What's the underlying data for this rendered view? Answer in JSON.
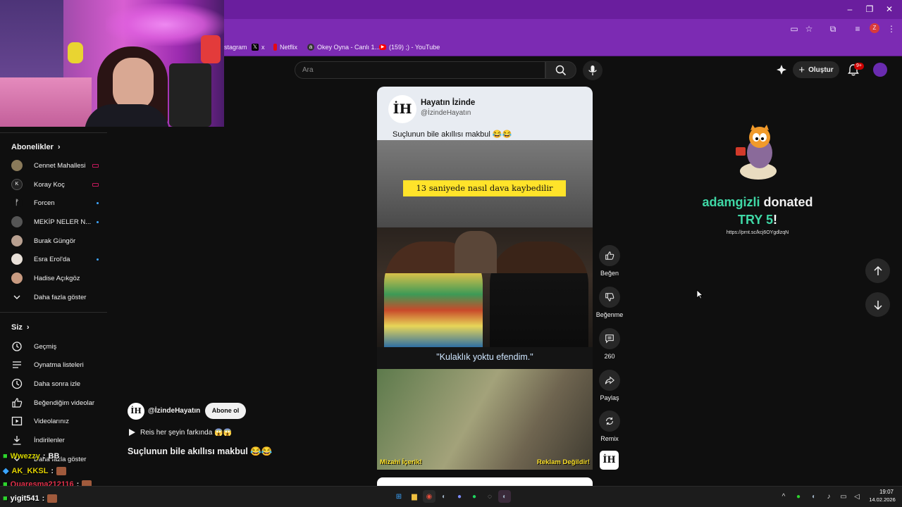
{
  "browser": {
    "bookmarks": [
      {
        "label": "stagram",
        "icon": "instagram-icon",
        "color": "#7c2bb3"
      },
      {
        "label": "x",
        "icon": "x-icon",
        "color": "#000000"
      },
      {
        "label": "Netflix",
        "icon": "netflix-icon",
        "color": "#e50914"
      },
      {
        "label": "Okey Oyna - Canlı 1...",
        "icon": "okey-icon",
        "color": "#222222"
      },
      {
        "label": "(159) ;) - YouTube",
        "icon": "youtube-icon",
        "color": "#ff0000"
      }
    ],
    "profile_letter": "Z"
  },
  "sidebar": {
    "subscriptions_title": "Abonelikler",
    "subscriptions": [
      {
        "label": "Cennet Mahallesi",
        "indicator": "live",
        "avatar_color": "#8a7a5a"
      },
      {
        "label": "Koray Koç",
        "indicator": "live",
        "avatar_color": "#222222"
      },
      {
        "label": "Forcen",
        "indicator": "dot",
        "avatar_color": "#0f0f0f"
      },
      {
        "label": "MEKİP NELER N...",
        "indicator": "dot",
        "avatar_color": "#555555"
      },
      {
        "label": "Burak Güngör",
        "indicator": "none",
        "avatar_color": "#b8a090"
      },
      {
        "label": "Esra Erol'da",
        "indicator": "dot",
        "avatar_color": "#e8e0d8"
      },
      {
        "label": "Hadise Açıkgöz",
        "indicator": "none",
        "avatar_color": "#c89a80"
      }
    ],
    "show_more": "Daha fazla göster",
    "you_title": "Siz",
    "you_items": [
      {
        "label": "Geçmiş",
        "icon": "history-icon"
      },
      {
        "label": "Oynatma listeleri",
        "icon": "playlist-icon"
      },
      {
        "label": "Daha sonra izle",
        "icon": "clock-icon"
      },
      {
        "label": "Beğendiğim videolar",
        "icon": "like-icon"
      },
      {
        "label": "Videolarınız",
        "icon": "video-icon"
      },
      {
        "label": "İndirilenler",
        "icon": "download-icon"
      },
      {
        "label": "Daha fazla göster",
        "icon": "chevron-down-icon"
      }
    ]
  },
  "header": {
    "search_placeholder": "Ara",
    "create_label": "Oluştur",
    "notification_badge": "9+"
  },
  "short": {
    "tweet_name": "Hayatın İzinde",
    "tweet_handle": "@İzindeHayatın",
    "tweet_text": "Suçlunun bile akıllısı makbul 😂😂",
    "avatar_text": "İH",
    "yellow_caption": "13 saniyede nasıl dava kaybedilir",
    "blue_caption": "\"Kulaklık yoktu efendim.\"",
    "badge_left": "Mizahi İçerik!",
    "badge_right": "Reklam Değildir!",
    "channel_name": "@İzindeHayatın",
    "subscribe_label": "Abone ol",
    "music": "Reis her şeyin farkında 😱😱",
    "title": "Suçlunun bile akıllısı makbul 😂😂"
  },
  "actions": {
    "like": "Beğen",
    "dislike": "Beğenme",
    "comments": "260",
    "share": "Paylaş",
    "remix": "Remix"
  },
  "donation": {
    "user": "adamgizli",
    "verb": "donated",
    "amount": "TRY 5",
    "exclaim": "!",
    "url": "https://prnt.sc/kcj6OYgdlzqN",
    "user_color": "#3fd8a6"
  },
  "chat": [
    {
      "user": "Wwezzy",
      "text": "BB",
      "color": "#d4d400"
    },
    {
      "user": "AK_KKSL",
      "text": ":",
      "color": "#e0d000"
    },
    {
      "user": "Quaresma212116",
      "text": ":",
      "color": "#e0304a"
    },
    {
      "user": "yigit541",
      "text": ":",
      "color": "#ffffff"
    }
  ],
  "taskbar": {
    "time": "19:07",
    "date": "14.02.2026"
  }
}
